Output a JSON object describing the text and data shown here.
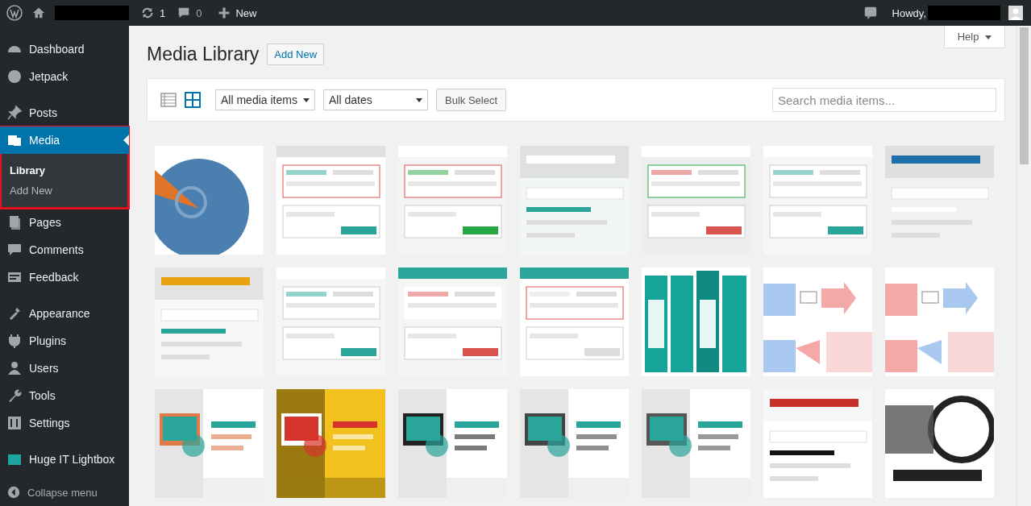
{
  "admin_bar": {
    "updates": "1",
    "comments": "0",
    "new": "New",
    "greeting": "Howdy,"
  },
  "sidebar": {
    "groups": [
      [
        {
          "label": "Dashboard",
          "selected": false
        },
        {
          "label": "Jetpack",
          "selected": false
        }
      ],
      [
        {
          "label": "Posts",
          "selected": false
        },
        {
          "label": "Media",
          "selected": true,
          "highlighted": true,
          "submenu": [
            {
              "label": "Library",
              "selected": true
            },
            {
              "label": "Add New",
              "selected": false
            }
          ]
        },
        {
          "label": "Pages",
          "selected": false
        },
        {
          "label": "Comments",
          "selected": false
        },
        {
          "label": "Feedback",
          "selected": false
        }
      ],
      [
        {
          "label": "Appearance",
          "selected": false
        },
        {
          "label": "Plugins",
          "selected": false
        },
        {
          "label": "Users",
          "selected": false
        },
        {
          "label": "Tools",
          "selected": false
        },
        {
          "label": "Settings",
          "selected": false
        }
      ],
      [
        {
          "label": "Huge IT Lightbox",
          "selected": false
        }
      ]
    ],
    "collapse": "Collapse menu"
  },
  "help": "Help",
  "title": "Media Library",
  "add_new": "Add New",
  "toolbar": {
    "views": [
      {
        "kind": "list",
        "selected": false
      },
      {
        "kind": "grid",
        "selected": true
      }
    ],
    "type_filter": "All media items",
    "date_filter": "All dates",
    "bulk": "Bulk Select",
    "search": {
      "placeholder": "Search media items..."
    }
  }
}
